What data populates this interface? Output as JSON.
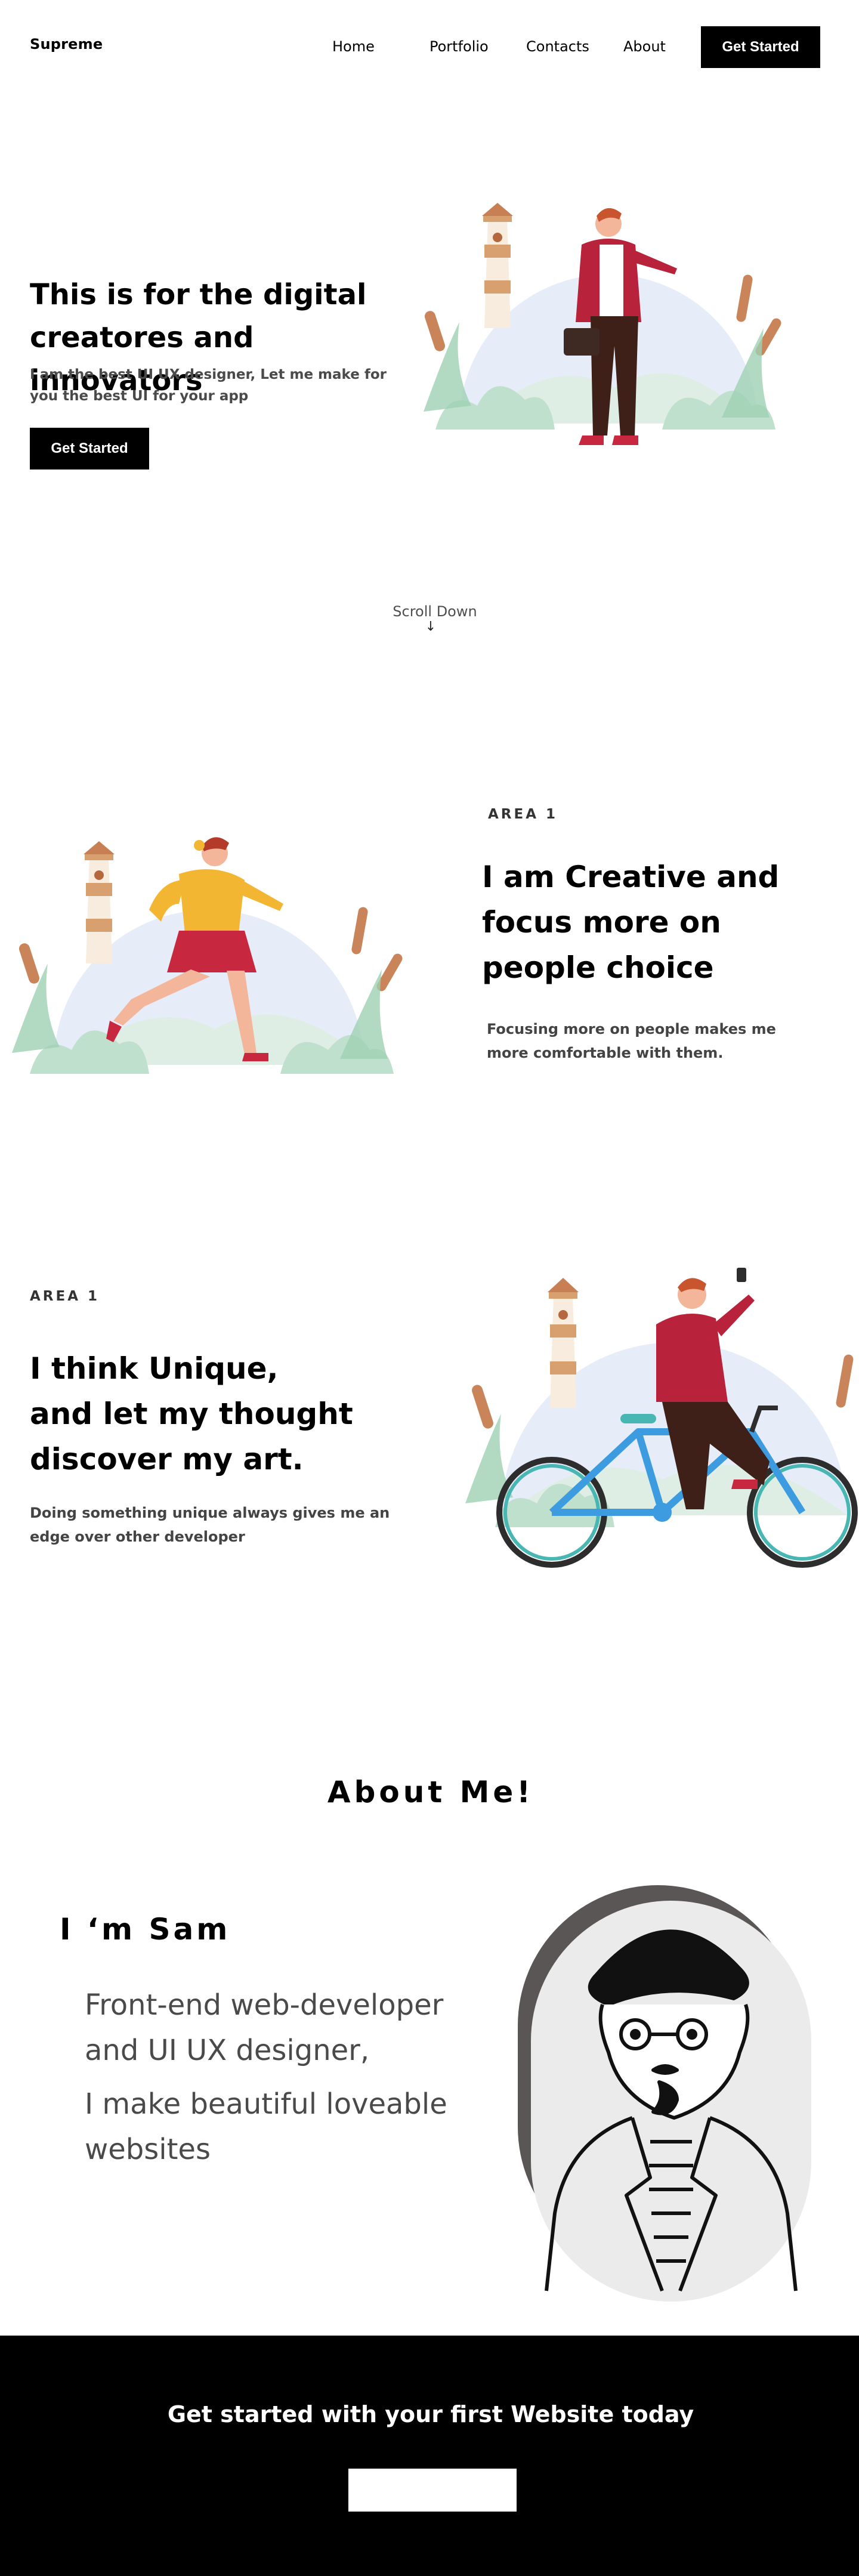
{
  "brand": {
    "logo": "Supreme"
  },
  "nav": {
    "home": "Home",
    "portfolio": "Portfolio",
    "contacts": "Contacts",
    "about": "About",
    "cta": "Get Started"
  },
  "hero": {
    "title": "This is for the digital creatores and innovators",
    "subtitle": "I am the best UI UX designer, Let me make for you the best UI for your app",
    "cta": "Get Started"
  },
  "scroll": {
    "label": "Scroll Down",
    "arrow": "↓"
  },
  "section1": {
    "area": "AREA 1",
    "title": "I am Creative and focus more on people choice",
    "description": "Focusing more on people makes me more comfortable with them."
  },
  "section2": {
    "area": "AREA 1",
    "title_line1": "I think Unique,",
    "title_line2": "and let my thought",
    "title_line3": "discover my art.",
    "description": "Doing something unique always gives me an edge over other developer"
  },
  "about": {
    "title": "About Me!",
    "name": "I ‘m Sam",
    "line1": "Front-end web-developer and UI UX designer,",
    "line2": "I make beautiful loveable websites"
  },
  "footer": {
    "title": "Get started with your first Website today",
    "button": ""
  },
  "colors": {
    "accent": "#000000",
    "sky": "#e6edf9",
    "shirt_red": "#b8223a",
    "skirt_red": "#c8283f",
    "sweater_yellow": "#f2b632",
    "cattail": "#c98459",
    "foliage": "#bfe0cd",
    "bike_blue": "#3d9be0",
    "portrait_bg": "#5b5656"
  },
  "icons": {
    "scroll": "down-arrow-icon"
  }
}
